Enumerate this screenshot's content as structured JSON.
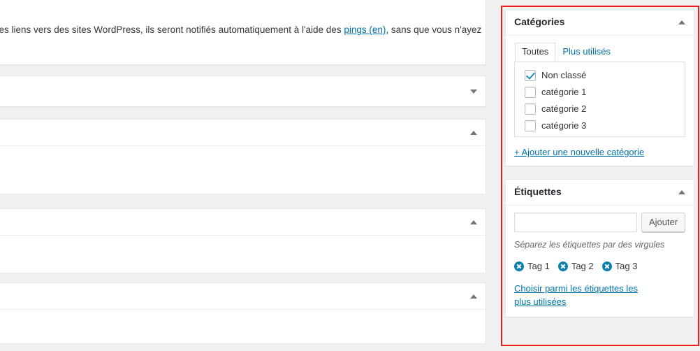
{
  "editor": {
    "discussion_text_before": "des liens vers des sites WordPress, ils seront notifiés automatiquement à l'aide des ",
    "discussion_link": "pings (en)",
    "discussion_text_after": ", sans que vous n'ayez"
  },
  "left_panels": [
    {
      "name": "collapsed-panel-1",
      "toggle": "chevron-down-icon"
    },
    {
      "name": "expanded-panel-2",
      "toggle": "chevron-up-icon"
    },
    {
      "name": "expanded-panel-3",
      "toggle": "chevron-up-icon"
    },
    {
      "name": "expanded-panel-4",
      "toggle": "chevron-up-icon"
    }
  ],
  "categories_box": {
    "title": "Catégories",
    "toggle_icon": "chevron-up-icon",
    "tabs": [
      {
        "label": "Toutes",
        "active": true
      },
      {
        "label": "Plus utilisés",
        "active": false
      }
    ],
    "items": [
      {
        "label": "Non classé",
        "checked": true
      },
      {
        "label": "catégorie 1",
        "checked": false
      },
      {
        "label": "catégorie 2",
        "checked": false
      },
      {
        "label": "catégorie 3",
        "checked": false
      }
    ],
    "add_link": "+ Ajouter une nouvelle catégorie"
  },
  "tags_box": {
    "title": "Étiquettes",
    "toggle_icon": "chevron-up-icon",
    "input_value": "",
    "input_placeholder": "",
    "add_button": "Ajouter",
    "hint": "Séparez les étiquettes par des virgules",
    "tags": [
      {
        "label": "Tag 1"
      },
      {
        "label": "Tag 2"
      },
      {
        "label": "Tag 3"
      }
    ],
    "choose_link": "Choisir parmi les étiquettes les plus utilisées"
  },
  "colors": {
    "highlight": "#ee1c1c",
    "link": "#0073aa",
    "checkbox_check": "#1e8cbe",
    "tag_remove": "#0b7fae",
    "page_bg": "#f1f1f1",
    "panel_bg": "#ffffff",
    "panel_border": "#e5e5e5"
  }
}
